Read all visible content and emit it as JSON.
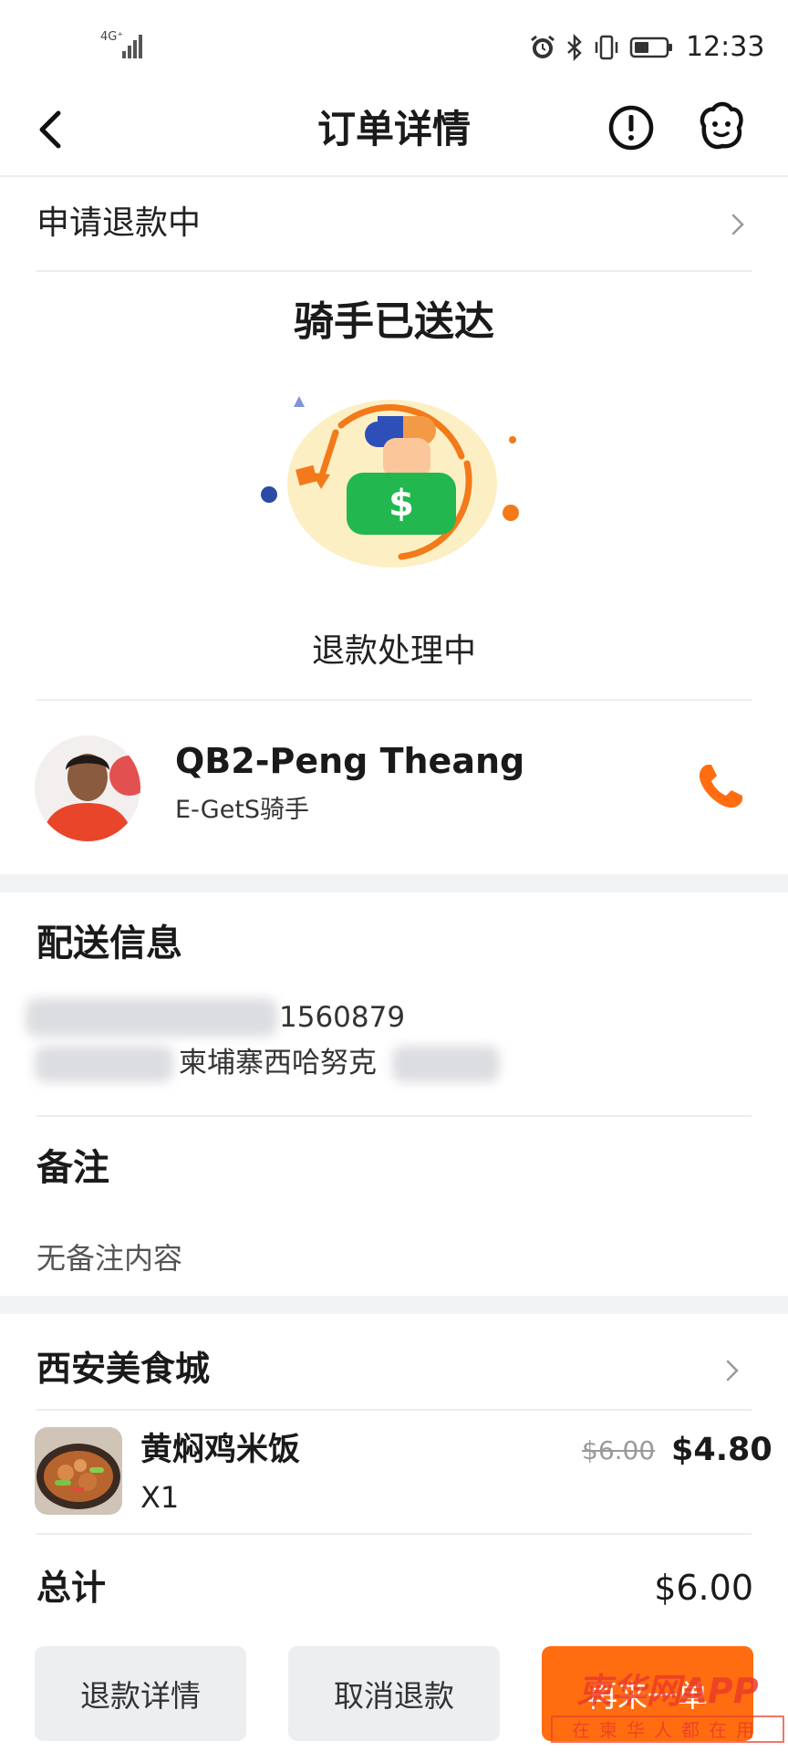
{
  "status_bar": {
    "network": "4G⁺",
    "time": "12:33"
  },
  "header": {
    "title": "订单详情",
    "back_icon": "chevron-left-icon",
    "alert_icon": "exclamation-circle-icon",
    "service_icon": "customer-service-icon"
  },
  "refund_status": {
    "label": "申请退款中"
  },
  "order_status": {
    "title": "骑手已送达",
    "subtitle": "退款处理中"
  },
  "rider": {
    "name": "QB2-Peng Theang",
    "role": "E-GetS骑手",
    "call_icon": "phone-icon",
    "accent": "#ff6d10"
  },
  "delivery_info": {
    "title": "配送信息",
    "phone": "1560879",
    "address": "柬埔寨西哈努克"
  },
  "remark": {
    "title": "备注",
    "content": "无备注内容"
  },
  "store": {
    "name": "西安美食城"
  },
  "order_items": [
    {
      "name": "黄焖鸡米饭",
      "qty": "X1",
      "original_price": "$6.00",
      "price": "$4.80"
    }
  ],
  "total": {
    "label": "总计",
    "value": "$6.00"
  },
  "actions": {
    "refund_detail": "退款详情",
    "cancel_refund": "取消退款",
    "third": "再来一单"
  },
  "watermark": {
    "top": "柬华网APP",
    "bottom": "在柬华人都在用"
  }
}
